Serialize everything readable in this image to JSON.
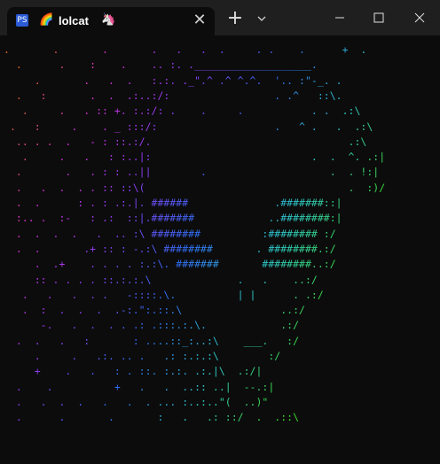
{
  "tab": {
    "icon_label": "PS",
    "rainbow_icon": "🌈",
    "title": "lolcat",
    "unicorn_icon": "🦄",
    "close_glyph": "✕"
  },
  "toolbar": {
    "new_tab_glyph": "+"
  },
  "terminal": {
    "lines": [
      ".       .       .       .   .   .  .     . .    .      +  .",
      "  .      .    :    .    .. :. .___________________.",
      "     .       .   .  .   :.:. ._\".^ .^ ^.^.  '.. :\"-_. .",
      "  .   :       .  .  .:..:/:                 . .^   ::\\.",
      "   .     .   . :: +. :.:/: .    .     .           . .  .:\\",
      " .   :     .    . _ :::/:                   .   ^ .   .  .:\\",
      "  .. . .  .   - : ::.:/.                                .:\\",
      "   .     .   .   : :..|:                          .  .  ^. .:|",
      "  .       .   . : : ..||        .                    .  . !:|",
      "  .   .  .  . . :: ::\\(                                 .  :)/",
      "  .  .      : . : .:.|. ######              .#######::|",
      "  :.. .  :-   : .:  ::|.#######            ..########:|",
      "  .  .  .  .   .  .. :\\ ########          :######## :/",
      "  .  .       .+ :: : -.:\\ ########       . ########.:/",
      "     .  .+    . . . . :.:\\. #######       ########..:/",
      "     :: . . . . ::.:.:.\\              .   .    ..:/",
      "   .   .   .  . .   -::::.\\.          | |      . .:/",
      "   .  :  .  .  .  .-:.\":.::.\\                ..:/",
      "      -.   .  .  . . .: .:::.:.\\.            .:/",
      "  .  .   .   :       : ....::_:..:\\    ___.   :/",
      "     .     .   .:. .. .   .: :.:.:\\        :/",
      "     +    .   .   : . ::. :.:. .:.|\\  .:/|",
      "  .    .          +   .   .  ..:: ..|  --.:|",
      "  .   .  .  .   .   .  . ... :..:..\"(  ..)\"",
      "  .      .       .       :   .   .: ::/  .  .::\\"
    ]
  },
  "colors": {
    "background": "#0c0c0c",
    "titlebar": "#1f1f1f",
    "tab_active": "#0c0c0c",
    "rainbow_start": "#e06a1b",
    "rainbow_mid_magenta": "#d62fd6",
    "rainbow_mid_violet": "#8a3cf0",
    "rainbow_mid_blue": "#2f6cf0",
    "rainbow_mid_cyan": "#2ec4c4",
    "rainbow_end": "#3bd62f"
  }
}
